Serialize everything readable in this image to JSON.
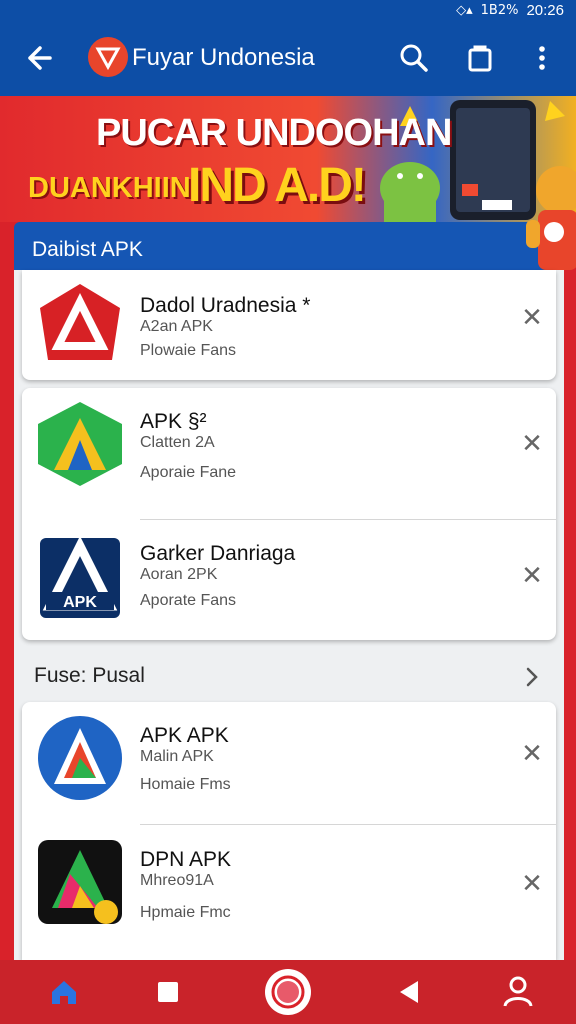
{
  "status_bar": {
    "signal": "◆ ◢",
    "battery": "18% ▮",
    "time": "20:26",
    "battery_text": "1B2%"
  },
  "app_bar": {
    "title": "Fuyar Undonesia",
    "logo_glyph": "Ω"
  },
  "banner": {
    "line1": "PUCAR UNDOOHAN",
    "line2a": "DUANKHIIN",
    "line2b": "IND A.D!"
  },
  "section1": {
    "title": "Daibist APK"
  },
  "apps_group1": [
    {
      "name": "Dadol Uradnesia *",
      "sub": "A2an APK",
      "meta": "Plowaie Fans"
    }
  ],
  "apps_group2": [
    {
      "name": "APK §²",
      "sub": "Clatten 2A",
      "meta": "Aporaie Fane"
    },
    {
      "name": "Garker Danriaga",
      "sub": "Aoran 2PK",
      "meta": "Aporate Fans"
    }
  ],
  "section2": {
    "title": "Fuse: Pusal"
  },
  "apps_group3": [
    {
      "name": "APK APK",
      "sub": "Malin APK",
      "meta": "Homaie Fms"
    },
    {
      "name": "DPN APK",
      "sub": "Mhreo91A",
      "meta": "Hpmaie Fmc"
    }
  ],
  "colors": {
    "primary": "#0d4ea6",
    "accent_red": "#d9222a",
    "nav_red": "#c9232a",
    "banner_yellow": "#ffd21e"
  },
  "icons": {
    "back": "arrow-left-icon",
    "search": "search-icon",
    "bag": "shopping-bag-icon",
    "more": "more-vert-icon",
    "close": "close-icon",
    "chevron": "chevron-right-icon",
    "nav": [
      "home-icon",
      "square-icon",
      "circle-icon",
      "triangle-back-icon",
      "user-icon"
    ]
  },
  "close_glyph": "✕"
}
